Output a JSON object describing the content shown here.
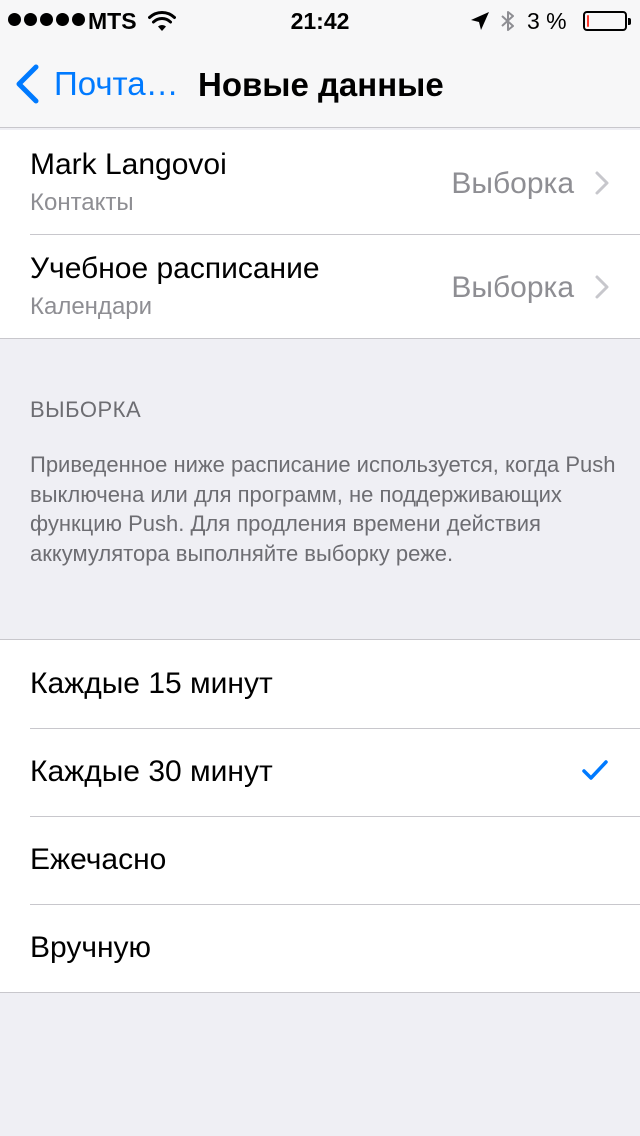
{
  "status_bar": {
    "carrier": "MTS",
    "time": "21:42",
    "battery_percent": "3 %",
    "battery_level": 0.03,
    "signal_dots": 5
  },
  "nav": {
    "back_label": "Почта…",
    "title": "Новые данные"
  },
  "accounts": [
    {
      "name": "Mark Langovoi",
      "subtitle": "Контакты",
      "value": "Выборка"
    },
    {
      "name": "Учебное расписание",
      "subtitle": "Календари",
      "value": "Выборка"
    }
  ],
  "fetch_section": {
    "header": "ВЫБОРКА",
    "footer": "Приведенное ниже расписание используется, когда Push выключена или для программ, не поддерживающих функцию Push. Для продления времени действия аккумулятора выполняйте выборку реже."
  },
  "options": [
    {
      "label": "Каждые 15 минут",
      "selected": false
    },
    {
      "label": "Каждые 30 минут",
      "selected": true
    },
    {
      "label": "Ежечасно",
      "selected": false
    },
    {
      "label": "Вручную",
      "selected": false
    }
  ],
  "colors": {
    "accent": "#007aff",
    "background": "#efeff4",
    "secondary_text": "#8e8e93",
    "battery_low": "#ff3b30"
  }
}
